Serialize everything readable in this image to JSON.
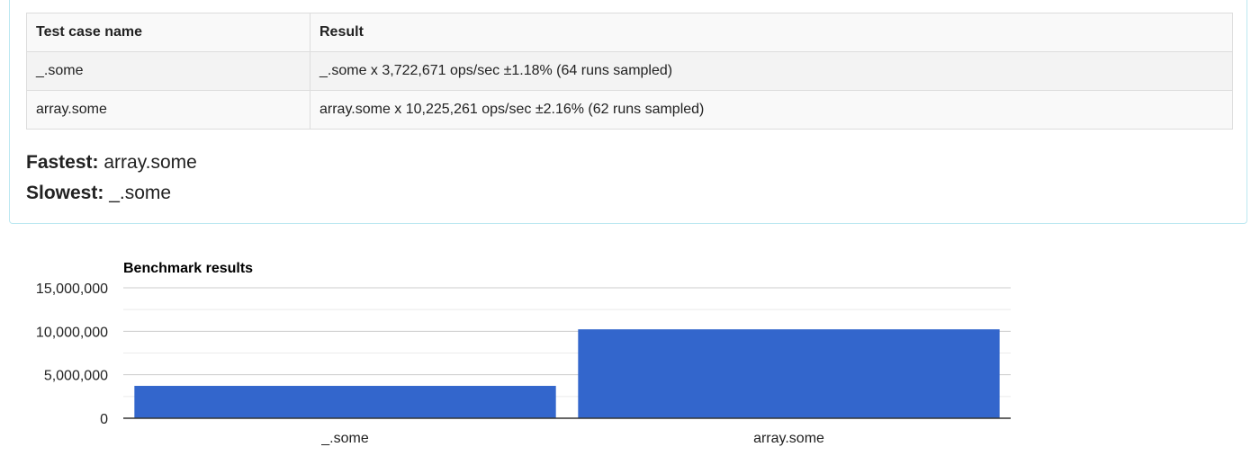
{
  "results_table": {
    "headers": [
      "Test case name",
      "Result"
    ],
    "rows": [
      {
        "name": "_.some",
        "result": "_.some x 3,722,671 ops/sec ±1.18% (64 runs sampled)"
      },
      {
        "name": "array.some",
        "result": "array.some x 10,225,261 ops/sec ±2.16% (62 runs sampled)"
      }
    ]
  },
  "summary": {
    "fastest_label": "Fastest:",
    "fastest_value": " array.some",
    "slowest_label": "Slowest:",
    "slowest_value": " _.some"
  },
  "colors": {
    "bar": "#3366cc",
    "gridline": "#cccccc",
    "minor_gridline": "#ebebeb",
    "baseline": "#333333"
  },
  "chart_data": {
    "type": "bar",
    "title": "Benchmark results",
    "categories": [
      "_.some",
      "array.some"
    ],
    "values": [
      3722671,
      10225261
    ],
    "ylim": [
      0,
      15000000
    ],
    "yticks": [
      0,
      5000000,
      10000000,
      15000000
    ],
    "ytick_labels": [
      "0",
      "5,000,000",
      "10,000,000",
      "15,000,000"
    ],
    "grid": true,
    "legend": "none"
  }
}
